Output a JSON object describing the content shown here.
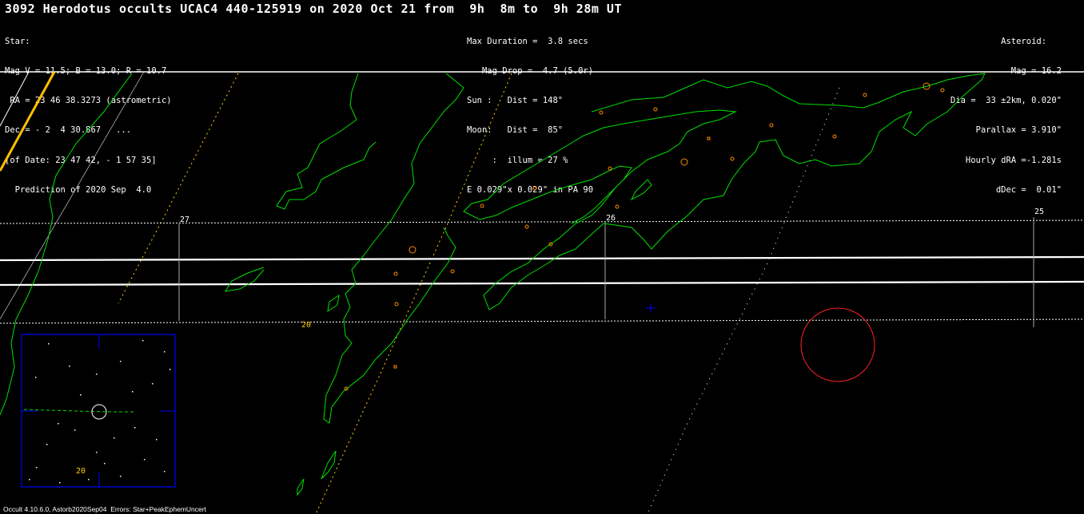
{
  "title": "3092 Herodotus occults UCAC4 440-125919 on 2020 Oct 21 from  9h  8m to  9h 28m UT",
  "star_block": [
    "Star:",
    "Mag V = 11.5; B = 13.0; R = 10.7",
    " RA = 23 46 38.3273 (astrometric)",
    "Dec = - 2  4 30.867   ...",
    "[of Date: 23 47 42, - 1 57 35]",
    "  Prediction of 2020 Sep  4.0"
  ],
  "event_block": [
    "Max Duration =  3.8 secs",
    "   Mag Drop =  4.7 (5.0r)",
    "Sun :   Dist = 148°",
    "Moon:   Dist =  85°",
    "     :  illum = 27 %",
    "E 0.029\"x 0.029\" in PA 90"
  ],
  "asteroid_block": [
    "Asteroid:   ",
    "Mag = 16.2",
    "Dia =  33 ±2km, 0.020\"",
    "Parallax = 3.910\"",
    "Hourly dRA =-1.281s",
    "dDec =  0.01\""
  ],
  "footer": "Occult 4.10.6.0, Astorb2020Sep04  Errors: Star+PeakEphemUncert",
  "longitude_labels": [
    "27",
    "26",
    "25"
  ],
  "finder_label": "20",
  "colors": {
    "background": "#000000",
    "coast": "#00e000",
    "path_center": "#ffffff",
    "path_sigma": "#ffffff",
    "track": "#ffd000",
    "sites": "#ff8c00",
    "shadow_circle": "#ff2020",
    "finder_frame": "#0000ff",
    "target_cross": "#0000ff"
  }
}
